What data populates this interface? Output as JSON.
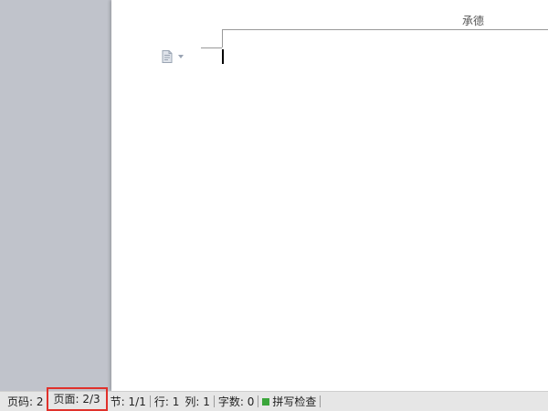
{
  "document": {
    "header_text": "承德"
  },
  "statusbar": {
    "page_code": "页码: 2",
    "page_count": "页面: 2/3",
    "section": "节: 1/1",
    "line": "行: 1",
    "column": "列: 1",
    "word_count": "字数: 0",
    "spell_check": "拼写检查"
  },
  "icons": {
    "paragraph_options": "document-icon",
    "dropdown": "chevron-down-icon",
    "spell_status": "square-indicator-icon"
  },
  "colors": {
    "workspace": "#c0c3cb",
    "page": "#ffffff",
    "statusbar": "#e6e6e6",
    "highlight_box": "#e0312b",
    "spell_ok": "#3aa53a"
  }
}
